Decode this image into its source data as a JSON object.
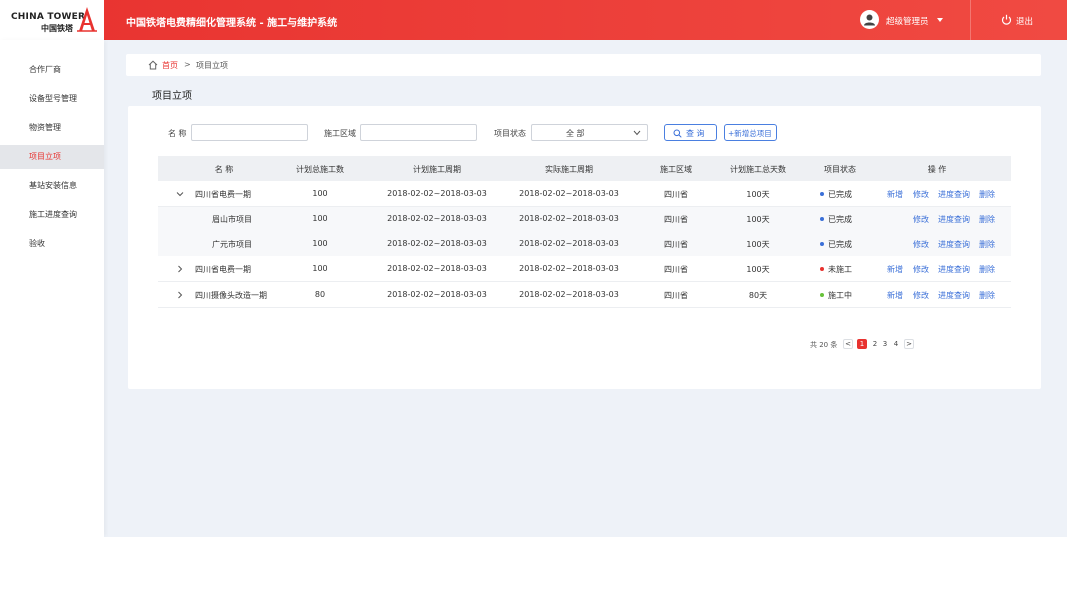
{
  "header": {
    "logo_en": "CHINA TOWER",
    "logo_cn": "中国铁塔",
    "title": "中国铁塔电费精细化管理系统 - 施工与维护系统",
    "user_name": "超级管理员",
    "logout": "退出",
    "colors": {
      "brand": "#e8322f"
    }
  },
  "sidebar": {
    "items": [
      {
        "label": "合作厂商"
      },
      {
        "label": "设备型号管理"
      },
      {
        "label": "物资管理"
      },
      {
        "label": "项目立项"
      },
      {
        "label": "基站安装信息"
      },
      {
        "label": "施工进度查询"
      },
      {
        "label": "验收"
      }
    ],
    "active_index": 3
  },
  "breadcrumb": {
    "home": "首页",
    "sep": ">",
    "current": "项目立项"
  },
  "page_title": "项目立项",
  "filters": {
    "name_label": "名 称",
    "name_value": "",
    "area_label": "施工区域",
    "area_value": "",
    "status_label": "项目状态",
    "status_value": "全 部",
    "query_label": "查 询",
    "add_label": "+新增总项目"
  },
  "table": {
    "columns": [
      "名 称",
      "计划总施工数",
      "计划施工周期",
      "实际施工周期",
      "施工区域",
      "计划施工总天数",
      "项目状态",
      "操 作"
    ],
    "rows": [
      {
        "name": "四川省电费一期",
        "planned": "100",
        "plan_period": "2018-02-02~2018-03-03",
        "actual_period": "2018-02-02~2018-03-03",
        "area": "四川省",
        "days": "100天",
        "status": "已完成",
        "status_color": "#3a6fd8",
        "ops": [
          "新增",
          "修改",
          "进度查询",
          "删除"
        ],
        "expanded": true,
        "child": false
      },
      {
        "name": "眉山市项目",
        "planned": "100",
        "plan_period": "2018-02-02~2018-03-03",
        "actual_period": "2018-02-02~2018-03-03",
        "area": "四川省",
        "days": "100天",
        "status": "已完成",
        "status_color": "#3a6fd8",
        "ops": [
          "修改",
          "进度查询",
          "删除"
        ],
        "child": true
      },
      {
        "name": "广元市项目",
        "planned": "100",
        "plan_period": "2018-02-02~2018-03-03",
        "actual_period": "2018-02-02~2018-03-03",
        "area": "四川省",
        "days": "100天",
        "status": "已完成",
        "status_color": "#3a6fd8",
        "ops": [
          "修改",
          "进度查询",
          "删除"
        ],
        "child": true
      },
      {
        "name": "四川省电费一期",
        "planned": "100",
        "plan_period": "2018-02-02~2018-03-03",
        "actual_period": "2018-02-02~2018-03-03",
        "area": "四川省",
        "days": "100天",
        "status": "未施工",
        "status_color": "#e8322f",
        "ops": [
          "新增",
          "修改",
          "进度查询",
          "删除"
        ],
        "expanded": false,
        "child": false
      },
      {
        "name": "四川摄像头改造一期",
        "planned": "80",
        "plan_period": "2018-02-02~2018-03-03",
        "actual_period": "2018-02-02~2018-03-03",
        "area": "四川省",
        "days": "80天",
        "status": "施工中",
        "status_color": "#67c23a",
        "ops": [
          "新增",
          "修改",
          "进度查询",
          "删除"
        ],
        "expanded": false,
        "child": false
      }
    ]
  },
  "pagination": {
    "total_text": "共 20 条",
    "prev": "<",
    "next": ">",
    "pages": [
      "1",
      "2",
      "3",
      "4"
    ],
    "current": "1"
  }
}
